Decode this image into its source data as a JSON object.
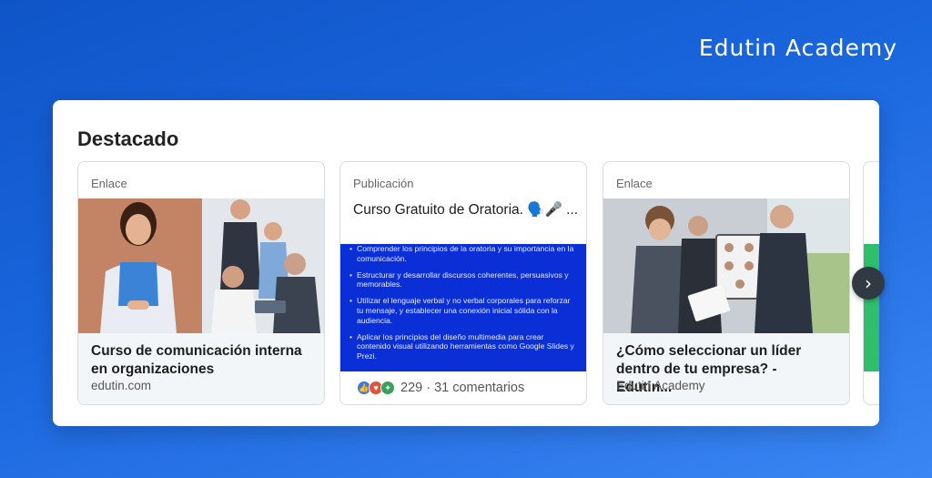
{
  "brand": {
    "name": "Edutin Academy"
  },
  "featured": {
    "title": "Destacado",
    "cards": [
      {
        "type": "Enlace",
        "title": "Curso de comunicación interna en organizaciones",
        "subtitle": "edutin.com"
      },
      {
        "type": "Publicación",
        "title": "Curso Gratuito de Oratoria. 🗣️🎤 ...",
        "image_bullets": [
          "Comprender los principios de la oratoria y su importancia en la comunicación.",
          "Estructurar y desarrollar discursos coherentes, persuasivos y memorables.",
          "Utilizar el lenguaje verbal y no verbal corporales para reforzar tu mensaje, y establecer una conexión inicial sólida con la audiencia.",
          "Aplicar los principios del diseño multimedia para crear contenido visual utilizando herramientas como Google Slides y Prezi."
        ],
        "stats": "229 · 31 comentarios"
      },
      {
        "type": "Enlace",
        "title": "¿Cómo seleccionar un líder dentro de tu empresa? - Edutin...",
        "subtitle": "Edutin Academy"
      }
    ],
    "next_icon": "chevron-right-icon"
  }
}
